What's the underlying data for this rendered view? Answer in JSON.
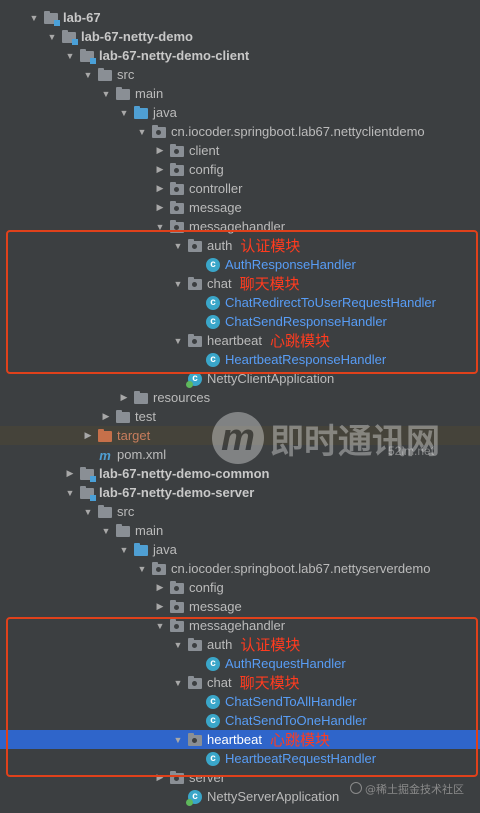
{
  "tree": [
    {
      "id": "lab67",
      "indent": 0,
      "arrow": "open",
      "icon": "folder-module",
      "label": "lab-67",
      "style": "module"
    },
    {
      "id": "demo",
      "indent": 1,
      "arrow": "open",
      "icon": "folder-module",
      "label": "lab-67-netty-demo",
      "style": "module"
    },
    {
      "id": "client",
      "indent": 2,
      "arrow": "open",
      "icon": "folder-module",
      "label": "lab-67-netty-demo-client",
      "style": "module"
    },
    {
      "id": "src",
      "indent": 3,
      "arrow": "open",
      "icon": "folder",
      "label": "src"
    },
    {
      "id": "main",
      "indent": 4,
      "arrow": "open",
      "icon": "folder",
      "label": "main"
    },
    {
      "id": "java",
      "indent": 5,
      "arrow": "open",
      "icon": "folder-blue",
      "label": "java"
    },
    {
      "id": "pkg-client",
      "indent": 6,
      "arrow": "open",
      "icon": "folder-pkg",
      "label": "cn.iocoder.springboot.lab67.nettyclientdemo"
    },
    {
      "id": "c-client",
      "indent": 7,
      "arrow": "closed",
      "icon": "folder-pkg",
      "label": "client"
    },
    {
      "id": "c-config",
      "indent": 7,
      "arrow": "closed",
      "icon": "folder-pkg",
      "label": "config"
    },
    {
      "id": "c-controller",
      "indent": 7,
      "arrow": "closed",
      "icon": "folder-pkg",
      "label": "controller"
    },
    {
      "id": "c-message",
      "indent": 7,
      "arrow": "closed",
      "icon": "folder-pkg",
      "label": "message"
    },
    {
      "id": "c-messagehandler",
      "indent": 7,
      "arrow": "open",
      "icon": "folder-pkg",
      "label": "messagehandler"
    },
    {
      "id": "c-auth",
      "indent": 8,
      "arrow": "open",
      "icon": "folder-pkg",
      "label": "auth",
      "annotation": "认证模块"
    },
    {
      "id": "c-AuthResponseHandler",
      "indent": 9,
      "arrow": "none",
      "icon": "class",
      "label": "AuthResponseHandler",
      "style": "class-name"
    },
    {
      "id": "c-chat",
      "indent": 8,
      "arrow": "open",
      "icon": "folder-pkg",
      "label": "chat",
      "annotation": "聊天模块"
    },
    {
      "id": "c-ChatRedirect",
      "indent": 9,
      "arrow": "none",
      "icon": "class",
      "label": "ChatRedirectToUserRequestHandler",
      "style": "class-name"
    },
    {
      "id": "c-ChatSendResponse",
      "indent": 9,
      "arrow": "none",
      "icon": "class",
      "label": "ChatSendResponseHandler",
      "style": "class-name"
    },
    {
      "id": "c-heartbeat",
      "indent": 8,
      "arrow": "open",
      "icon": "folder-pkg",
      "label": "heartbeat",
      "annotation": "心跳模块"
    },
    {
      "id": "c-HeartbeatResponse",
      "indent": 9,
      "arrow": "none",
      "icon": "class",
      "label": "HeartbeatResponseHandler",
      "style": "class-name"
    },
    {
      "id": "c-app",
      "indent": 8,
      "arrow": "none",
      "icon": "app",
      "label": "NettyClientApplication"
    },
    {
      "id": "c-resources",
      "indent": 5,
      "arrow": "closed",
      "icon": "folder",
      "label": "resources"
    },
    {
      "id": "c-test",
      "indent": 4,
      "arrow": "closed",
      "icon": "folder",
      "label": "test"
    },
    {
      "id": "c-target",
      "indent": 3,
      "arrow": "closed",
      "icon": "folder-orange",
      "label": "target",
      "style": "target",
      "band": true
    },
    {
      "id": "c-pom",
      "indent": 3,
      "arrow": "none",
      "icon": "maven",
      "label": "pom.xml"
    },
    {
      "id": "common",
      "indent": 2,
      "arrow": "closed",
      "icon": "folder-module",
      "label": "lab-67-netty-demo-common",
      "style": "module"
    },
    {
      "id": "server",
      "indent": 2,
      "arrow": "open",
      "icon": "folder-module",
      "label": "lab-67-netty-demo-server",
      "style": "module"
    },
    {
      "id": "s-src",
      "indent": 3,
      "arrow": "open",
      "icon": "folder",
      "label": "src"
    },
    {
      "id": "s-main",
      "indent": 4,
      "arrow": "open",
      "icon": "folder",
      "label": "main"
    },
    {
      "id": "s-java",
      "indent": 5,
      "arrow": "open",
      "icon": "folder-blue",
      "label": "java"
    },
    {
      "id": "pkg-server",
      "indent": 6,
      "arrow": "open",
      "icon": "folder-pkg",
      "label": "cn.iocoder.springboot.lab67.nettyserverdemo"
    },
    {
      "id": "s-config",
      "indent": 7,
      "arrow": "closed",
      "icon": "folder-pkg",
      "label": "config"
    },
    {
      "id": "s-message",
      "indent": 7,
      "arrow": "closed",
      "icon": "folder-pkg",
      "label": "message"
    },
    {
      "id": "s-messagehandler",
      "indent": 7,
      "arrow": "open",
      "icon": "folder-pkg",
      "label": "messagehandler"
    },
    {
      "id": "s-auth",
      "indent": 8,
      "arrow": "open",
      "icon": "folder-pkg",
      "label": "auth",
      "annotation": "认证模块"
    },
    {
      "id": "s-AuthRequest",
      "indent": 9,
      "arrow": "none",
      "icon": "class",
      "label": "AuthRequestHandler",
      "style": "class-name"
    },
    {
      "id": "s-chat",
      "indent": 8,
      "arrow": "open",
      "icon": "folder-pkg",
      "label": "chat",
      "annotation": "聊天模块"
    },
    {
      "id": "s-ChatSendToAll",
      "indent": 9,
      "arrow": "none",
      "icon": "class",
      "label": "ChatSendToAllHandler",
      "style": "class-name"
    },
    {
      "id": "s-ChatSendToOne",
      "indent": 9,
      "arrow": "none",
      "icon": "class",
      "label": "ChatSendToOneHandler",
      "style": "class-name"
    },
    {
      "id": "s-heartbeat",
      "indent": 8,
      "arrow": "open",
      "icon": "folder-pkg",
      "label": "heartbeat",
      "annotation": "心跳模块",
      "selected": true
    },
    {
      "id": "s-HeartbeatRequest",
      "indent": 9,
      "arrow": "none",
      "icon": "class",
      "label": "HeartbeatRequestHandler",
      "style": "class-name"
    },
    {
      "id": "s-server",
      "indent": 7,
      "arrow": "closed",
      "icon": "folder-pkg",
      "label": "server"
    },
    {
      "id": "s-app",
      "indent": 8,
      "arrow": "none",
      "icon": "app",
      "label": "NettyServerApplication"
    }
  ],
  "icons": {
    "arrow_open": "triangle-down-icon",
    "arrow_closed": "triangle-right-icon",
    "class_letter": "c",
    "app_letter": "c",
    "maven_letter": "m"
  },
  "watermark": {
    "logo_letter": "m",
    "text": "即时通讯网",
    "site": "52im.net"
  },
  "credit": "@稀土掘金技术社区",
  "colors": {
    "background": "#3c3f41",
    "selection": "#2f65ca",
    "annotation_red": "#ff3b1f",
    "class_blue": "#589df6",
    "target_orange": "#c77d5d"
  }
}
